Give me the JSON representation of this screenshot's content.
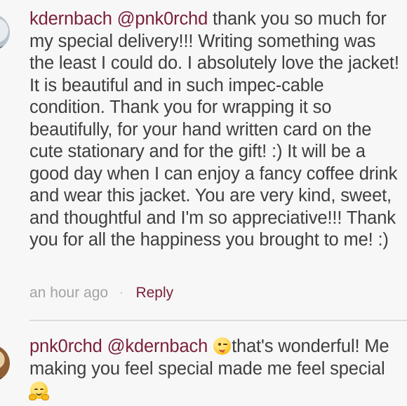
{
  "comments": [
    {
      "username": "kdernbach",
      "mention": "@pnk0rchd",
      "text": "thank you so much for my special delivery!!! Writing something was the least I could do. I absolutely love the jacket! It is beautiful and in such impec-cable condition. Thank you for wrapping it so beautifully, for your hand written card on the cute stationary and for the gift! :) It will be a good day when I can enjoy a fancy coffee drink and wear this jacket. You are very kind, sweet, and thoughtful and I'm so appreciative!!! Thank you for all the happiness you brought to me! :)",
      "timestamp": "an hour ago",
      "separator": "·",
      "reply_label": "Reply"
    },
    {
      "username": "pnk0rchd",
      "mention": "@kdernbach",
      "emoji_1": "winking-face-with-tongue-icon",
      "text_part1": "that's wonderful! Me making you feel special made me feel special",
      "emoji_2": "hugging-face-icon"
    }
  ],
  "colors": {
    "username": "#7a1f3a",
    "body_text": "#3e3e3e",
    "timestamp": "#a3a3a3",
    "background": "#f7f7f7",
    "divider": "#dcdcdc"
  }
}
